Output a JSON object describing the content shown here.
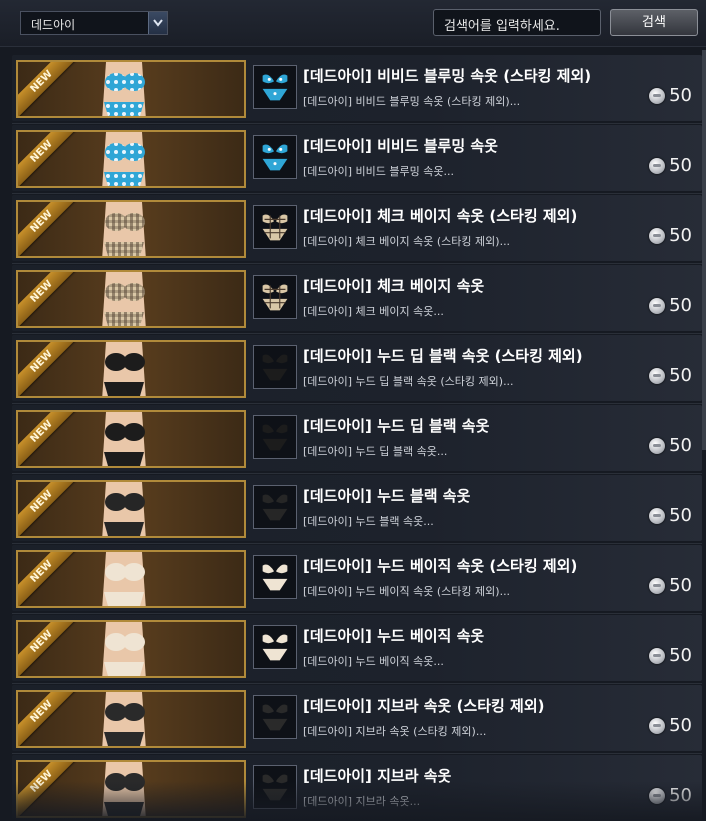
{
  "category_select": {
    "selected": "데드아이"
  },
  "search": {
    "placeholder": "검색어를 입력하세요.",
    "button_label": "검색"
  },
  "badge_label": "NEW",
  "items": [
    {
      "title": "[데드아이] 비비드 블루밍 속옷 (스타킹 제외)",
      "desc": "[데드아이] 비비드 블루밍 속옷 (스타킹 제외)...",
      "price": "50",
      "style": "blue-floral",
      "color": "#2fa6d6"
    },
    {
      "title": "[데드아이] 비비드 블루밍 속옷",
      "desc": "[데드아이] 비비드 블루밍 속옷...",
      "price": "50",
      "style": "blue-floral",
      "color": "#2fa6d6"
    },
    {
      "title": "[데드아이] 체크 베이지 속옷 (스타킹 제외)",
      "desc": "[데드아이] 체크 베이지 속옷 (스타킹 제외)...",
      "price": "50",
      "style": "check-beige",
      "color": "#d9c7a6"
    },
    {
      "title": "[데드아이] 체크 베이지 속옷",
      "desc": "[데드아이] 체크 베이지 속옷...",
      "price": "50",
      "style": "check-beige",
      "color": "#d9c7a6"
    },
    {
      "title": "[데드아이] 누드 딥 블랙 속옷 (스타킹 제외)",
      "desc": "[데드아이] 누드 딥 블랙 속옷 (스타킹 제외)...",
      "price": "50",
      "style": "black",
      "color": "#1c1c1c"
    },
    {
      "title": "[데드아이] 누드 딥 블랙 속옷",
      "desc": "[데드아이] 누드 딥 블랙 속옷...",
      "price": "50",
      "style": "black",
      "color": "#1c1c1c"
    },
    {
      "title": "[데드아이] 누드 블랙 속옷",
      "desc": "[데드아이] 누드 블랙 속옷...",
      "price": "50",
      "style": "black",
      "color": "#262626"
    },
    {
      "title": "[데드아이] 누드 베이직 속옷 (스타킹 제외)",
      "desc": "[데드아이] 누드 베이직 속옷 (스타킹 제외)...",
      "price": "50",
      "style": "nude",
      "color": "#efe4d3"
    },
    {
      "title": "[데드아이] 누드 베이직 속옷",
      "desc": "[데드아이] 누드 베이직 속옷...",
      "price": "50",
      "style": "nude",
      "color": "#efe4d3"
    },
    {
      "title": "[데드아이] 지브라 속옷 (스타킹 제외)",
      "desc": "[데드아이] 지브라 속옷 (스타킹 제외)...",
      "price": "50",
      "style": "black",
      "color": "#2a2a2a"
    },
    {
      "title": "[데드아이] 지브라 속옷",
      "desc": "[데드아이] 지브라 속옷...",
      "price": "50",
      "style": "black",
      "color": "#2a2a2a"
    }
  ]
}
